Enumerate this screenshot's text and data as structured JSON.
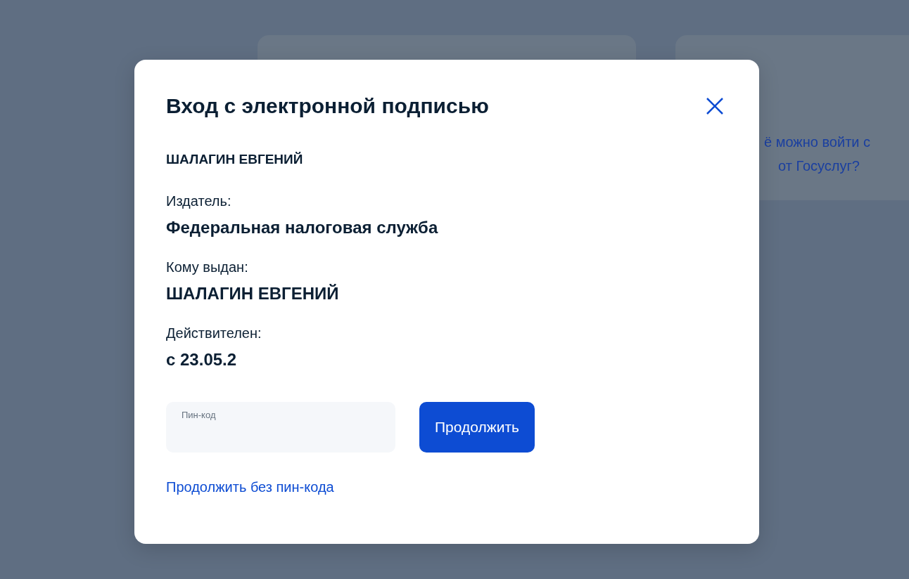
{
  "background_card": {
    "lines": [
      "ё можно войти с",
      "от Госуслуг?"
    ]
  },
  "modal": {
    "title": "Вход с электронной подписью",
    "certificate_name": "ШАЛАГИН ЕВГЕНИЙ",
    "fields": [
      {
        "label": "Издатель:",
        "value": "Федеральная налоговая служба"
      },
      {
        "label": "Кому выдан:",
        "value": "ШАЛАГИН ЕВГЕНИЙ"
      },
      {
        "label": "Действителен:",
        "value": "с 23.05.2"
      }
    ],
    "pin_field": {
      "label": "Пин-код"
    },
    "continue_button": "Продолжить",
    "skip_pin_link": "Продолжить без пин-кода"
  }
}
